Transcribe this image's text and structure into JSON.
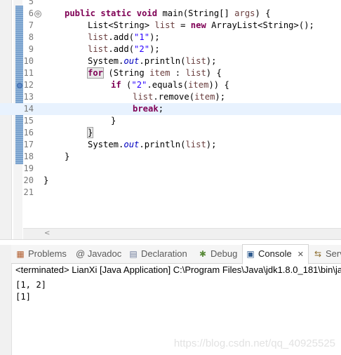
{
  "editor": {
    "lines": [
      {
        "n": "5"
      },
      {
        "n": "6"
      },
      {
        "n": "7"
      },
      {
        "n": "8"
      },
      {
        "n": "9"
      },
      {
        "n": "10"
      },
      {
        "n": "11"
      },
      {
        "n": "12"
      },
      {
        "n": "13"
      },
      {
        "n": "14"
      },
      {
        "n": "15"
      },
      {
        "n": "16"
      },
      {
        "n": "17"
      },
      {
        "n": "18"
      },
      {
        "n": "19"
      },
      {
        "n": "20"
      },
      {
        "n": "21"
      }
    ],
    "code": {
      "l6": {
        "kw1": "public",
        "kw2": "static",
        "kw3": "void",
        "rest": " main(String[] ",
        "param": "args",
        "end": ") {"
      },
      "l7": {
        "a": "List<String> ",
        "v": "list",
        "b": " = ",
        "kw": "new",
        "c": " ArrayList<String>();"
      },
      "l8": {
        "v": "list",
        "a": ".add(",
        "s": "\"1\"",
        "b": ");"
      },
      "l9": {
        "v": "list",
        "a": ".add(",
        "s": "\"2\"",
        "b": ");"
      },
      "l10": {
        "a": "System.",
        "f": "out",
        "b": ".println(",
        "v": "list",
        "c": ");"
      },
      "l11": {
        "kw": "for",
        "a": " (String ",
        "v": "item",
        "b": " : ",
        "v2": "list",
        "c": ") {"
      },
      "l12": {
        "kw": "if",
        "a": " (",
        "s": "\"2\"",
        "b": ".equals(",
        "v": "item",
        "c": ")) {"
      },
      "l13": {
        "v": "list",
        "a": ".remove(",
        "v2": "item",
        "b": ");"
      },
      "l14": {
        "kw": "break",
        "a": ";"
      },
      "l15": {
        "a": "}"
      },
      "l16": {
        "a": "}"
      },
      "l17": {
        "a": "System.",
        "f": "out",
        "b": ".println(",
        "v": "list",
        "c": ");"
      },
      "l18": {
        "a": "}"
      },
      "l20": {
        "a": "}"
      }
    },
    "fold_glyph": "⊖",
    "scroll_left": "<"
  },
  "tabs": [
    {
      "label": "Problems",
      "icon": "problems-icon",
      "glyph": "▦"
    },
    {
      "label": "@ Javadoc",
      "icon": "javadoc-icon",
      "glyph": ""
    },
    {
      "label": "Declaration",
      "icon": "declaration-icon",
      "glyph": "▤"
    },
    {
      "label": "Debug",
      "icon": "debug-icon",
      "glyph": "✱"
    },
    {
      "label": "Console",
      "icon": "console-icon",
      "glyph": "▣",
      "close": "✕"
    },
    {
      "label": "Serv",
      "icon": "servers-icon",
      "glyph": "⇆"
    }
  ],
  "console": {
    "description": "<terminated> LianXi [Java Application] C:\\Program Files\\Java\\jdk1.8.0_181\\bin\\ja",
    "output": [
      "[1, 2]",
      "[1]"
    ]
  },
  "watermark": "https://blog.csdn.net/qq_40925525",
  "colors": {
    "keyword": "#7f0055",
    "string": "#2a00ff",
    "field": "#0000c0",
    "current_line": "#e8f2fe"
  }
}
